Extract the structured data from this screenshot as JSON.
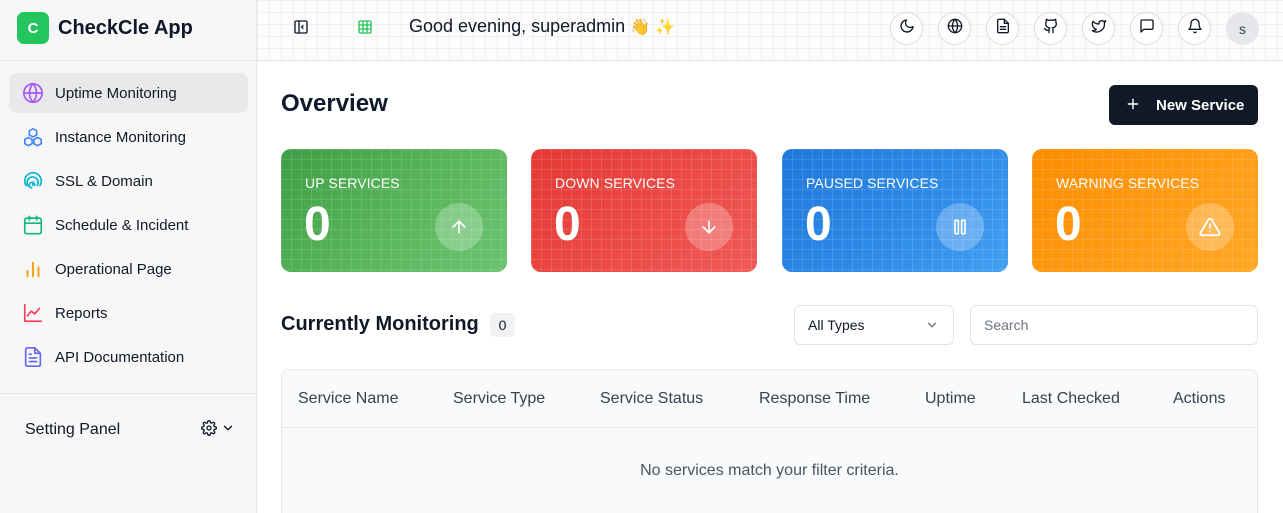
{
  "app": {
    "logo_letter": "C",
    "name": "CheckCle App"
  },
  "sidebar": {
    "items": [
      {
        "label": "Uptime Monitoring",
        "icon": "globe-icon",
        "color": "#a855f7",
        "active": true
      },
      {
        "label": "Instance Monitoring",
        "icon": "boxes-icon",
        "color": "#3b82f6",
        "active": false
      },
      {
        "label": "SSL & Domain",
        "icon": "fingerprint-icon",
        "color": "#06b6d4",
        "active": false
      },
      {
        "label": "Schedule & Incident",
        "icon": "calendar-icon",
        "color": "#10b981",
        "active": false
      },
      {
        "label": "Operational Page",
        "icon": "bar-chart-icon",
        "color": "#f59e0b",
        "active": false
      },
      {
        "label": "Reports",
        "icon": "line-chart-icon",
        "color": "#f43f5e",
        "active": false
      },
      {
        "label": "API Documentation",
        "icon": "document-icon",
        "color": "#6366f1",
        "active": false
      }
    ],
    "settings_label": "Setting Panel"
  },
  "header": {
    "greeting": "Good evening, superadmin",
    "greeting_emojis": "👋 ✨",
    "avatar_letter": "s",
    "actions": [
      "theme-moon-icon",
      "language-globe-icon",
      "docs-file-icon",
      "github-icon",
      "twitter-icon",
      "message-icon",
      "notification-bell-icon"
    ]
  },
  "overview": {
    "title": "Overview",
    "new_service_label": "New Service",
    "cards": [
      {
        "title": "UP SERVICES",
        "value": "0",
        "icon": "arrow-up-icon",
        "color": "#4caf50"
      },
      {
        "title": "DOWN SERVICES",
        "value": "0",
        "icon": "arrow-down-icon",
        "color": "#e53935"
      },
      {
        "title": "PAUSED SERVICES",
        "value": "0",
        "icon": "pause-icon",
        "color": "#1e88e5"
      },
      {
        "title": "WARNING SERVICES",
        "value": "0",
        "icon": "warning-triangle-icon",
        "color": "#fb8c00"
      }
    ]
  },
  "monitoring": {
    "title": "Currently Monitoring",
    "count": "0",
    "type_filter": "All Types",
    "search_placeholder": "Search",
    "columns": [
      "Service Name",
      "Service Type",
      "Service Status",
      "Response Time",
      "Uptime",
      "Last Checked",
      "Actions"
    ],
    "empty_message": "No services match your filter criteria."
  }
}
